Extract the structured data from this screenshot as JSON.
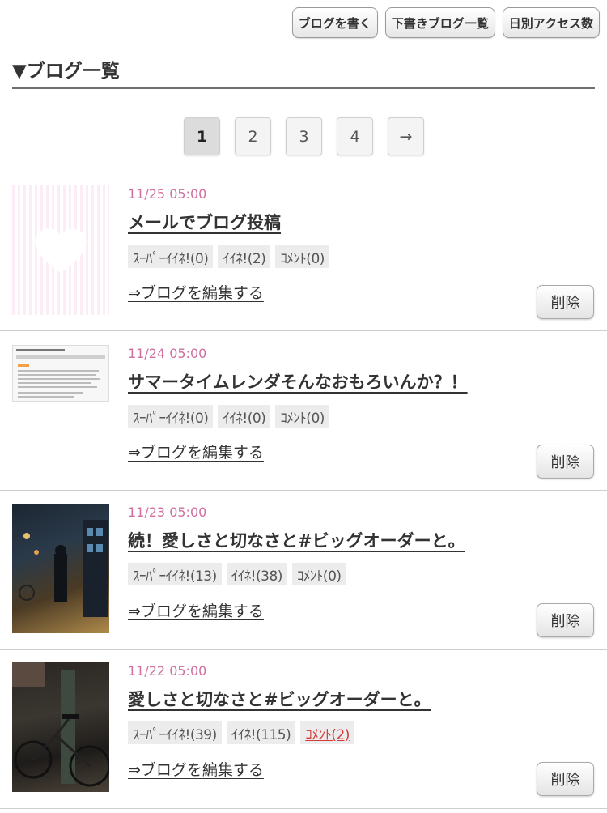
{
  "header": {
    "buttons": [
      "ブログを書く",
      "下書きブログ一覧",
      "日別アクセス数"
    ],
    "title": "▼ブログ一覧"
  },
  "pagination": {
    "pages": [
      "1",
      "2",
      "3",
      "4"
    ],
    "current": "1",
    "next": "→"
  },
  "entries": [
    {
      "date": "11/25 05:00",
      "title": "メールでブログ投稿",
      "super_like": "ｽｰﾊﾟｰｲｲﾈ!(0)",
      "like": "ｲｲﾈ!(2)",
      "comment": "ｺﾒﾝﾄ(0)",
      "edit": "⇒ブログを編集する",
      "delete": "削除"
    },
    {
      "date": "11/24 05:00",
      "title": "サマータイムレンダそんなおもろいんか？！",
      "super_like": "ｽｰﾊﾟｰｲｲﾈ!(0)",
      "like": "ｲｲﾈ!(0)",
      "comment": "ｺﾒﾝﾄ(0)",
      "edit": "⇒ブログを編集する",
      "delete": "削除"
    },
    {
      "date": "11/23 05:00",
      "title": "続！愛しさと切なさと#ビッグオーダーと。",
      "super_like": "ｽｰﾊﾟｰｲｲﾈ!(13)",
      "like": "ｲｲﾈ!(38)",
      "comment": "ｺﾒﾝﾄ(0)",
      "edit": "⇒ブログを編集する",
      "delete": "削除"
    },
    {
      "date": "11/22 05:00",
      "title": "愛しさと切なさと#ビッグオーダーと。",
      "super_like": "ｽｰﾊﾟｰｲｲﾈ!(39)",
      "like": "ｲｲﾈ!(115)",
      "comment": "ｺﾒﾝﾄ(2)",
      "edit": "⇒ブログを編集する",
      "delete": "削除"
    }
  ],
  "colors": {
    "date": "#d06fa0",
    "comment_alert": "#d03a3a"
  }
}
